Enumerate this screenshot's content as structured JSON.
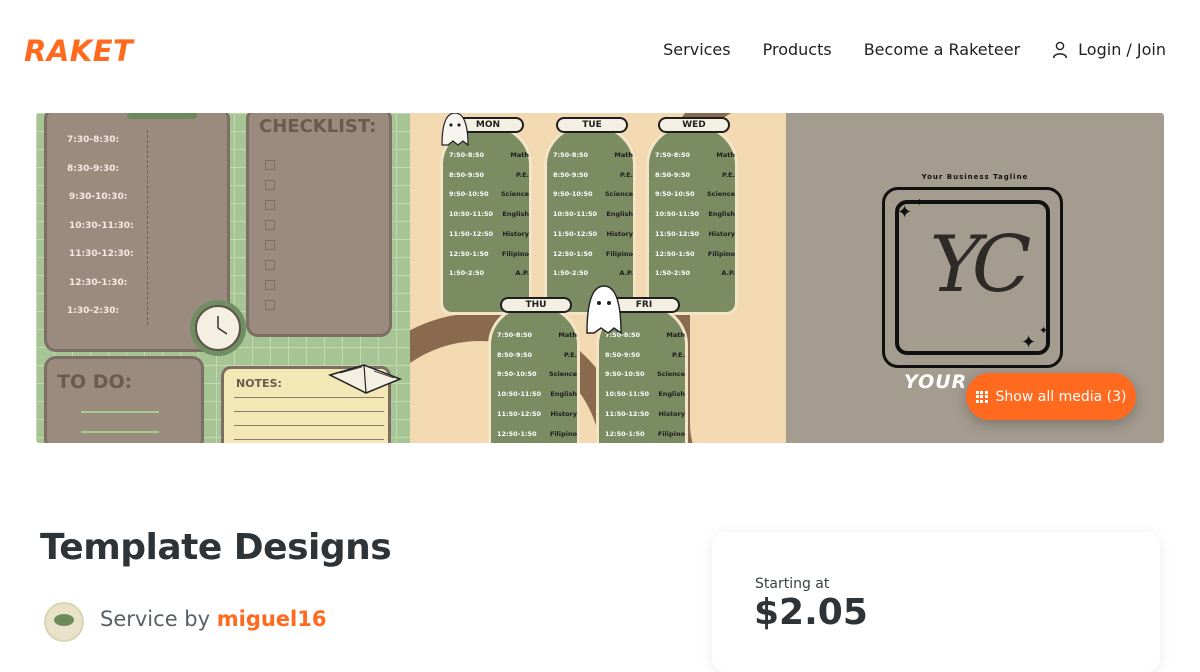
{
  "brand": {
    "logo": "RAKET",
    "accent": "#ff6a1f"
  },
  "nav": {
    "services": "Services",
    "products": "Products",
    "become": "Become a Raketeer",
    "login": "Login / Join"
  },
  "gallery": {
    "button_label": "Show all media (3)",
    "planner": {
      "times": [
        "7:30-8:30:",
        "8:30-9:30:",
        "9:30-10:30:",
        "10:30-11:30:",
        "11:30-12:30:",
        "12:30-1:30:",
        "1:30-2:30:"
      ],
      "checklist": "CHECKLIST:",
      "todo": "TO DO:",
      "notes": "NOTES:"
    },
    "timetable": {
      "days": [
        "MON",
        "TUE",
        "WED",
        "THU",
        "FRI"
      ],
      "rows": [
        {
          "time": "7:50-8:50",
          "subject": "Math"
        },
        {
          "time": "8:50-9:50",
          "subject": "P.E."
        },
        {
          "time": "9:50-10:50",
          "subject": "Science"
        },
        {
          "time": "10:50-11:50",
          "subject": "English"
        },
        {
          "time": "11:50-12:50",
          "subject": "History"
        },
        {
          "time": "12:50-1:50",
          "subject": "Filipino"
        },
        {
          "time": "1:50-2:50",
          "subject": "A.P."
        }
      ]
    },
    "logo_card": {
      "tagline": "Your Business Tagline",
      "monogram": "YC",
      "name_partial": "YOUR C"
    }
  },
  "service": {
    "title": "Template Designs",
    "service_by": "Service by",
    "seller": "miguel16"
  },
  "pricing": {
    "starting_label": "Starting at",
    "price": "$2.05"
  }
}
